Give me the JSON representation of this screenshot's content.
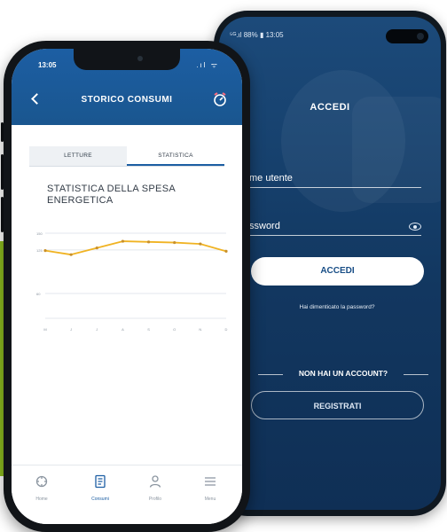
{
  "android": {
    "status_text": "⁵ᴳ.ıl 88% ▮ 13:05",
    "login_title": "ACCEDI",
    "username_label": "me utente",
    "password_label": "ssword",
    "login_button": "ACCEDI",
    "forgot_password": "Hai dimenticato la password?",
    "no_account": "NON HAI UN ACCOUNT?",
    "register_button": "REGISTRATI"
  },
  "iphone": {
    "time": "13:05",
    "status_icons": ".ıl ᯤ",
    "title": "STORICO CONSUMI",
    "tabs": [
      {
        "label": "LETTURE",
        "active": false
      },
      {
        "label": "STATISTICA",
        "active": true
      }
    ],
    "chart_title": "STATISTICA DELLA SPESA ENERGETICA",
    "nav": [
      {
        "label": "Home",
        "icon": "home-icon"
      },
      {
        "label": "Consumi",
        "icon": "consumption-icon"
      },
      {
        "label": "Profilo",
        "icon": "profile-icon"
      },
      {
        "label": "Menu",
        "icon": "menu-icon"
      }
    ]
  },
  "chart_data": {
    "type": "line",
    "categories": [
      "M",
      "J",
      "J",
      "A",
      "S",
      "O",
      "N",
      "D"
    ],
    "values": [
      124,
      118,
      128,
      138,
      137,
      136,
      134,
      123
    ],
    "ylim": [
      0,
      150
    ],
    "yticks": [
      "150",
      "125",
      "60"
    ],
    "yticks_values": [
      150,
      125,
      60
    ],
    "grid": true,
    "color": "#f0b323"
  },
  "colors": {
    "brand_blue": "#1c5ea3",
    "accent_green": "#8dbd1f",
    "chart_line": "#f0b323"
  }
}
